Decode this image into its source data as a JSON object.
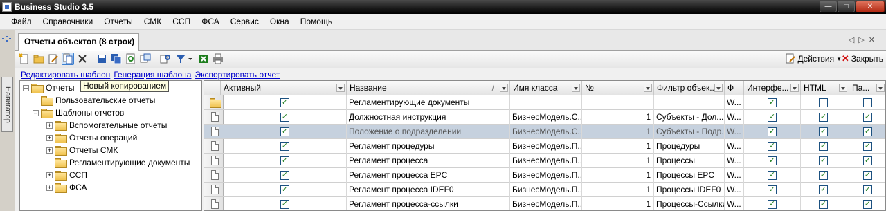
{
  "app": {
    "title": "Business Studio 3.5"
  },
  "menu": [
    "Файл",
    "Справочники",
    "Отчеты",
    "СМК",
    "ССП",
    "ФСА",
    "Сервис",
    "Окна",
    "Помощь"
  ],
  "navigator": {
    "label": "Навигатор"
  },
  "tab": {
    "title": "Отчеты объектов (8 строк)"
  },
  "toolbar": {
    "actions_label": "Действия",
    "close_label": "Закрыть"
  },
  "links": [
    "Редактировать шаблон",
    "Генерация шаблона",
    "Экспортировать отчет"
  ],
  "tooltip": "Новый копированием",
  "tree": [
    {
      "label": "Отчеты",
      "level": 0,
      "expander": "minus"
    },
    {
      "label": "Пользовательские отчеты",
      "level": 1,
      "expander": "none"
    },
    {
      "label": "Шаблоны отчетов",
      "level": 1,
      "expander": "minus"
    },
    {
      "label": "Вспомогательные отчеты",
      "level": 2,
      "expander": "plus"
    },
    {
      "label": "Отчеты операций",
      "level": 2,
      "expander": "plus"
    },
    {
      "label": "Отчеты СМК",
      "level": 2,
      "expander": "plus"
    },
    {
      "label": "Регламентирующие документы",
      "level": 2,
      "expander": "none"
    },
    {
      "label": "ССП",
      "level": 2,
      "expander": "plus"
    },
    {
      "label": "ФСА",
      "level": 2,
      "expander": "plus"
    }
  ],
  "grid": {
    "columns": [
      "Активный",
      "Название",
      "Имя класса",
      "№",
      "Фильтр объек...",
      "Ф",
      "Интерфе...",
      "HTML",
      "Па..."
    ],
    "rows": [
      {
        "icon": "folder",
        "active": true,
        "name": "Регламентирующие документы",
        "class": "",
        "num": "",
        "filter": "",
        "f": "W...",
        "iface": true,
        "html": false,
        "pa": false,
        "selected": false
      },
      {
        "icon": "doc",
        "active": true,
        "name": "Должностная инструкция",
        "class": "БизнесМодель.С...",
        "num": "1",
        "filter": "Субъекты - Дол...",
        "f": "W...",
        "iface": true,
        "html": true,
        "pa": true,
        "selected": false
      },
      {
        "icon": "doc",
        "active": true,
        "name": "Положение о подразделении",
        "class": "БизнесМодель.С...",
        "num": "1",
        "filter": "Субъекты - Подр...",
        "f": "W...",
        "iface": true,
        "html": true,
        "pa": true,
        "selected": true
      },
      {
        "icon": "doc",
        "active": true,
        "name": "Регламент процедуры",
        "class": "БизнесМодель.П...",
        "num": "1",
        "filter": "Процедуры",
        "f": "W...",
        "iface": true,
        "html": true,
        "pa": true,
        "selected": false
      },
      {
        "icon": "doc",
        "active": true,
        "name": "Регламент процесса",
        "class": "БизнесМодель.П...",
        "num": "1",
        "filter": "Процессы",
        "f": "W...",
        "iface": true,
        "html": true,
        "pa": true,
        "selected": false
      },
      {
        "icon": "doc",
        "active": true,
        "name": "Регламент процесса EPC",
        "class": "БизнесМодель.П...",
        "num": "1",
        "filter": "Процессы EPC",
        "f": "W...",
        "iface": true,
        "html": true,
        "pa": true,
        "selected": false
      },
      {
        "icon": "doc",
        "active": true,
        "name": "Регламент процесса IDEF0",
        "class": "БизнесМодель.П...",
        "num": "1",
        "filter": "Процессы IDEF0",
        "f": "W...",
        "iface": true,
        "html": true,
        "pa": true,
        "selected": false
      },
      {
        "icon": "doc",
        "active": true,
        "name": "Регламент процесса-ссылки",
        "class": "БизнесМодель.П...",
        "num": "1",
        "filter": "Процессы-Ссылки",
        "f": "W...",
        "iface": true,
        "html": true,
        "pa": true,
        "selected": false
      }
    ]
  }
}
